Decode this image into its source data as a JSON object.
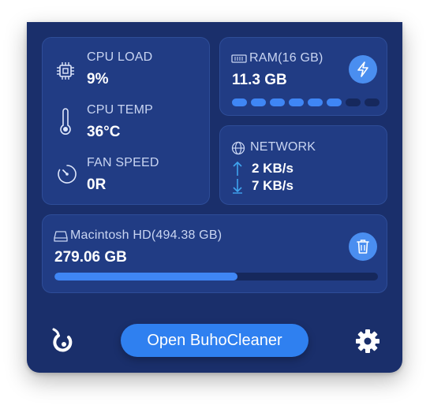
{
  "stats": {
    "cpu_load": {
      "label": "CPU LOAD",
      "value": "9%"
    },
    "cpu_temp": {
      "label": "CPU TEMP",
      "value": "36°C"
    },
    "fan_speed": {
      "label": "FAN SPEED",
      "value": "0R"
    }
  },
  "ram": {
    "label": "RAM(16 GB)",
    "value": "11.3 GB",
    "segments_total": 8,
    "segments_filled": 6
  },
  "network": {
    "label": "NETWORK",
    "upload": "2 KB/s",
    "download": "7 KB/s"
  },
  "disk": {
    "label": "Macintosh HD(494.38 GB)",
    "value": "279.06 GB",
    "used_fraction": 0.565
  },
  "footer": {
    "open_button_label": "Open BuhoCleaner"
  },
  "icons": {
    "cpu": "cpu-chip-icon",
    "temp": "thermometer-icon",
    "fan": "speedometer-icon",
    "ram": "memory-icon",
    "boost": "lightning-icon",
    "network": "globe-icon",
    "upload": "arrow-up-icon",
    "download": "arrow-down-icon",
    "disk": "hard-drive-icon",
    "trash": "trash-icon",
    "logo": "buho-logo-icon",
    "settings": "gear-icon"
  },
  "colors": {
    "panel_bg": "#1a2f6b",
    "card_bg": "#213c84",
    "accent": "#3f86f5",
    "network_arrows": "#3fa4f0"
  }
}
